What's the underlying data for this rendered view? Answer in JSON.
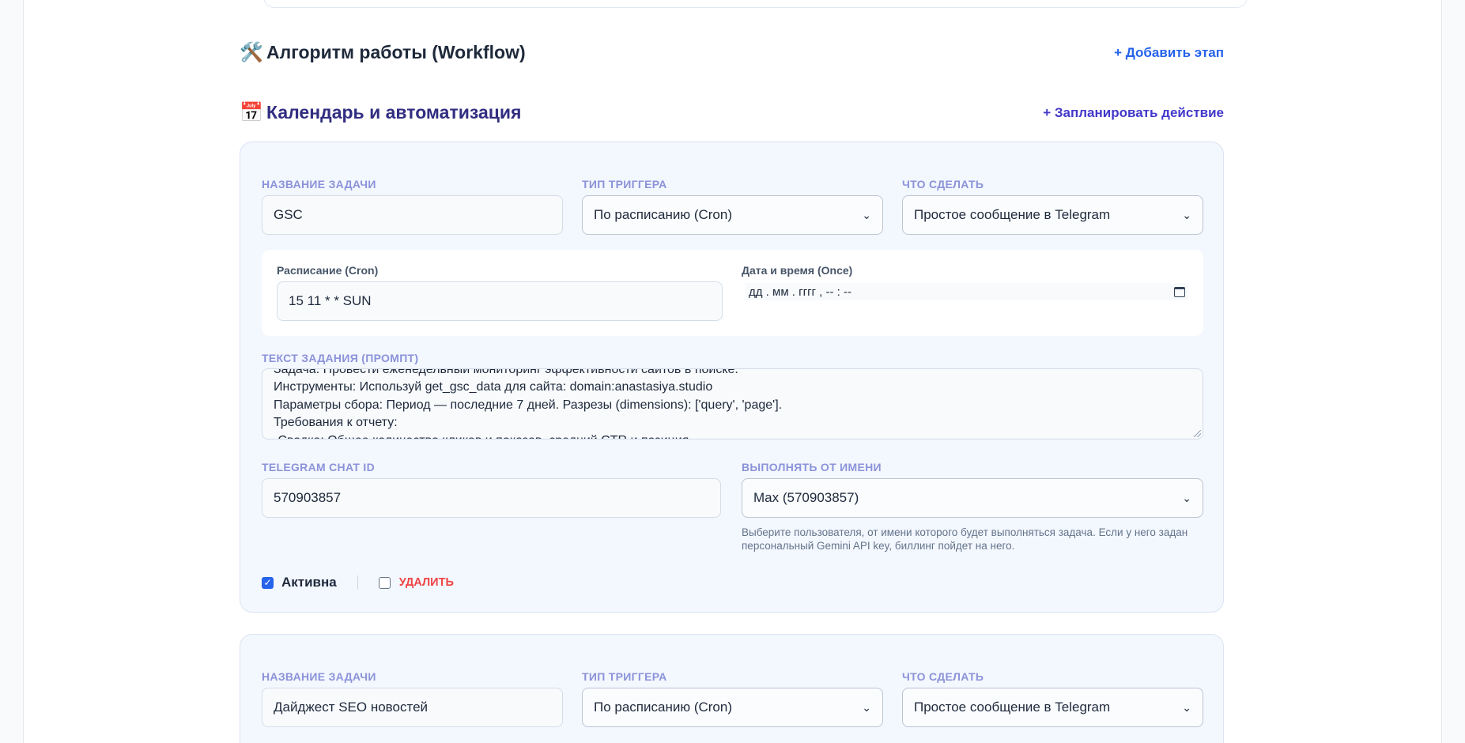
{
  "workflow": {
    "emoji": "🛠️",
    "title": "Алгоритм работы (Workflow)",
    "add_label": "+ Добавить этап"
  },
  "calendar": {
    "emoji": "📅",
    "title": "Календарь и автоматизация",
    "add_label": "+ Запланировать действие"
  },
  "labels": {
    "task_name": "НАЗВАНИЕ ЗАДАЧИ",
    "trigger_type": "ТИП ТРИГГЕРА",
    "action": "ЧТО СДЕЛАТЬ",
    "schedule": "Расписание (Cron)",
    "datetime": "Дата и время (Once)",
    "prompt": "ТЕКСТ ЗАДАНИЯ (ПРОМПТ)",
    "chat_id": "TELEGRAM CHAT ID",
    "run_as": "ВЫПОЛНЯТЬ ОТ ИМЕНИ",
    "active": "Активна",
    "delete": "УДАЛИТЬ"
  },
  "task1": {
    "name": "GSC",
    "trigger": "По расписанию (Cron)",
    "action": "Простое сообщение в Telegram",
    "cron": "15 11 * * SUN",
    "datetime_placeholder": "дд . мм . гггг ,  -- : --",
    "prompt_lines": [
      "Задача: Провести еженедельный мониторинг эффективности сайтов в поиске.",
      "Инструменты: Используй get_gsc_data для сайта: domain:anastasiya.studio",
      "Параметры сбора: Период — последние 7 дней. Разрезы (dimensions): ['query', 'page'].",
      "Требования к отчету:",
      "-Сводка: Общее количество кликов и показов, средний CTR и позиция."
    ],
    "chat_id": "570903857",
    "run_as": "Max (570903857)",
    "run_as_hint": "Выберите пользователя, от имени которого будет выполняться задача. Если у него задан персональный Gemini API key, биллинг пойдет на него.",
    "active": true
  },
  "task2": {
    "name": "Дайджест SEO новостей",
    "trigger": "По расписанию (Cron)",
    "action": "Простое сообщение в Telegram"
  }
}
